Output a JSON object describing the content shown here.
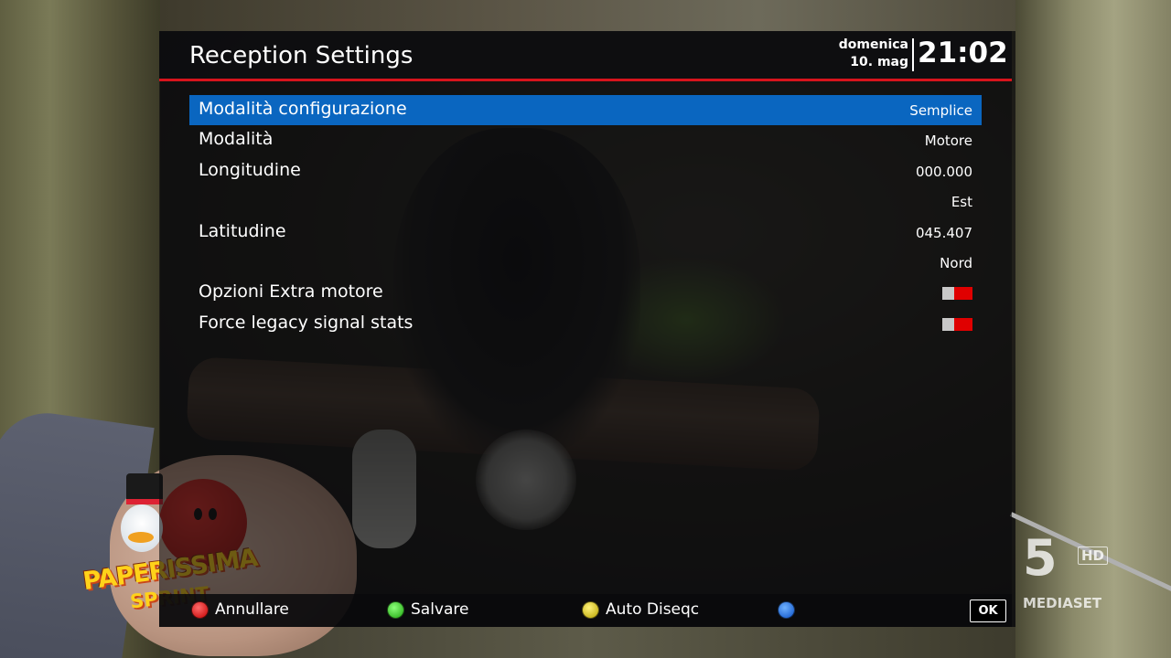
{
  "header": {
    "title": "Reception Settings",
    "day": "domenica",
    "date": "10. mag",
    "time": "21:02"
  },
  "settings": [
    {
      "label": "Modalità configurazione",
      "value": "Semplice",
      "selected": true
    },
    {
      "label": "Modalità",
      "value": "Motore"
    },
    {
      "label": "Longitudine",
      "value": "000.000"
    },
    {
      "label": "",
      "value": "Est"
    },
    {
      "label": "Latitudine",
      "value": "045.407"
    },
    {
      "label": "",
      "value": "Nord"
    },
    {
      "label": "Opzioni Extra motore",
      "toggle": "off"
    },
    {
      "label": "Force legacy signal stats",
      "toggle": "off"
    }
  ],
  "footer": {
    "red": "Annullare",
    "green": "Salvare",
    "yellow": "Auto Diseqc",
    "blue": "",
    "ok": "OK"
  },
  "overlay": {
    "logo_text_1": "PAPERISSIMA",
    "logo_text_2": "SPRINT",
    "channel_number": "5",
    "channel_hd": "HD",
    "channel_brand": "MEDIASET"
  },
  "colors": {
    "selection": "#0a66c0",
    "header_accent": "#d7141c",
    "toggle_off": "#e00000"
  }
}
